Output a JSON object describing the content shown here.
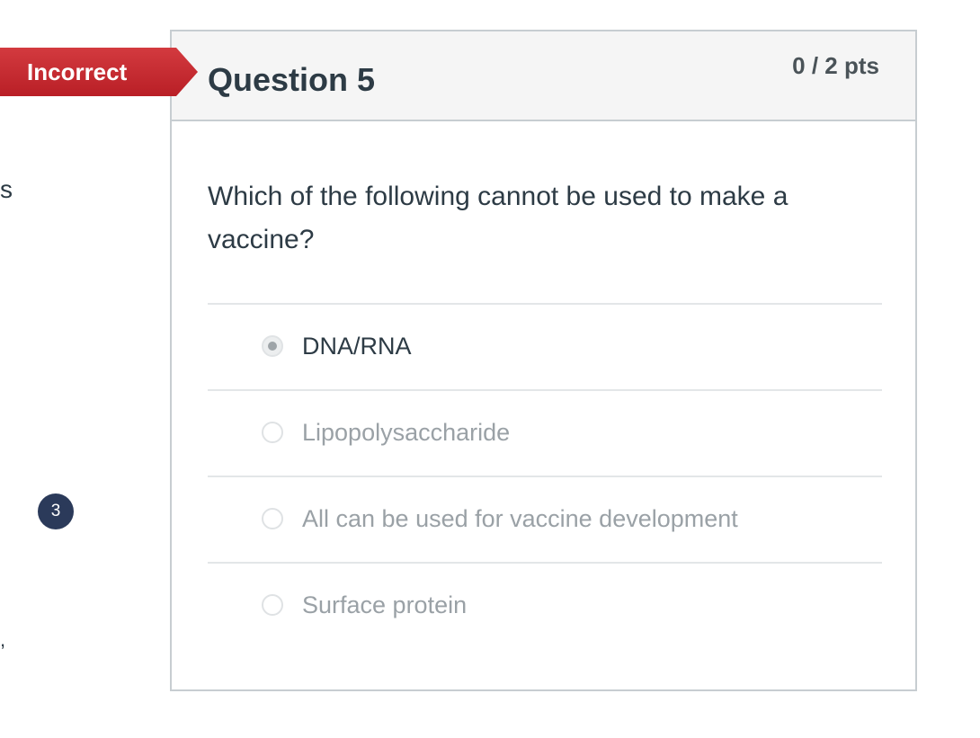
{
  "left_fragments": {
    "s_text": "s",
    "dot_text": ","
  },
  "badge": {
    "count": "3"
  },
  "ribbon": {
    "label": "Incorrect"
  },
  "question": {
    "title": "Question 5",
    "points": "0 / 2 pts",
    "text": "Which of the following cannot be used to make a vaccine?",
    "answers": [
      {
        "label": "DNA/RNA",
        "selected": true
      },
      {
        "label": "Lipopolysaccharide",
        "selected": false
      },
      {
        "label": "All can be used for vaccine development",
        "selected": false
      },
      {
        "label": "Surface protein",
        "selected": false
      }
    ]
  },
  "colors": {
    "ribbon": "#c8232c",
    "badge": "#2b3a5a",
    "header_bg": "#f5f5f5",
    "text_dark": "#2d3b45",
    "text_muted": "#9aa1a6"
  }
}
